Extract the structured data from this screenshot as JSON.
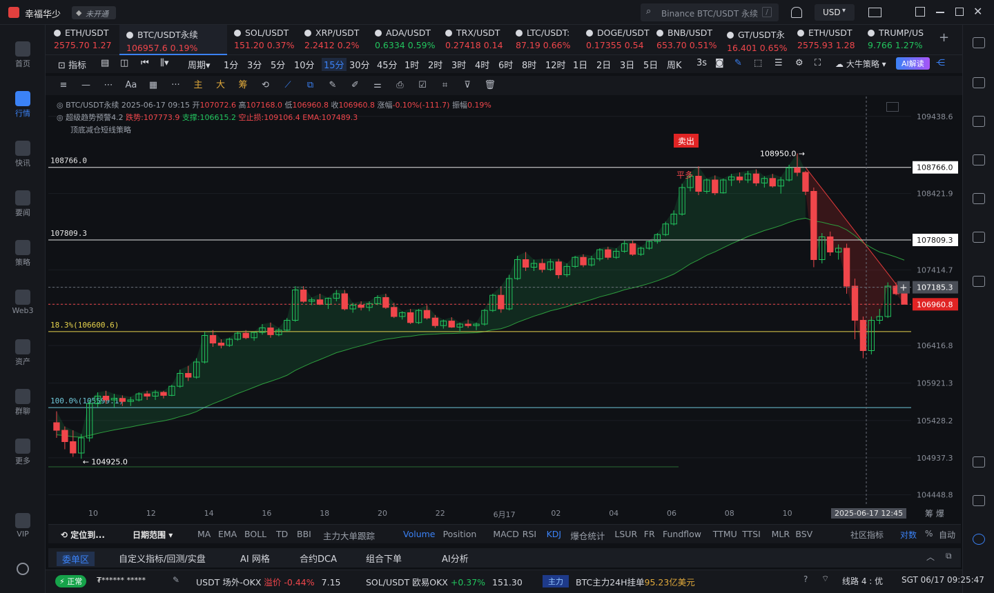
{
  "app": {
    "title": "幸福华少",
    "status_badge": "未开通",
    "search_placeholder": "Binance BTC/USDT 永续",
    "search_shortcut": "/",
    "currency": "USD"
  },
  "left_nav": [
    {
      "label": "首页",
      "icon": "home-icon"
    },
    {
      "label": "行情",
      "icon": "market-icon",
      "active": true
    },
    {
      "label": "快讯",
      "icon": "news-icon"
    },
    {
      "label": "要闻",
      "icon": "headline-icon"
    },
    {
      "label": "策略",
      "icon": "strategy-icon"
    },
    {
      "label": "Web3",
      "icon": "web3-icon"
    },
    {
      "label": "资产",
      "icon": "wallet-icon"
    },
    {
      "label": "群聊",
      "icon": "chat-icon"
    },
    {
      "label": "更多",
      "icon": "more-icon"
    },
    {
      "label": "VIP",
      "icon": "vip-icon"
    }
  ],
  "tickers": [
    {
      "name": "ETH/USDT",
      "price": "2575.70",
      "change": "1.27",
      "dir": "red"
    },
    {
      "name": "BTC/USDT永续",
      "price": "106957.6",
      "change": "0.19%",
      "dir": "red",
      "active": true
    },
    {
      "name": "SOL/USDT",
      "price": "151.20",
      "change": "0.37%",
      "dir": "red"
    },
    {
      "name": "XRP/USDT",
      "price": "2.2412",
      "change": "0.2%",
      "dir": "red"
    },
    {
      "name": "ADA/USDT",
      "price": "0.6334",
      "change": "0.59%",
      "dir": "green"
    },
    {
      "name": "TRX/USDT",
      "price": "0.27418",
      "change": "0.14",
      "dir": "red"
    },
    {
      "name": "LTC/USDT:",
      "price": "87.19",
      "change": "0.66%",
      "dir": "red"
    },
    {
      "name": "DOGE/USDT",
      "price": "0.17355",
      "change": "0.54",
      "dir": "red"
    },
    {
      "name": "BNB/USDT",
      "price": "653.70",
      "change": "0.51%",
      "dir": "red"
    },
    {
      "name": "GT/USDT永",
      "price": "16.401",
      "change": "0.65%",
      "dir": "red"
    },
    {
      "name": "ETH/USDT",
      "price": "2575.93",
      "change": "1.28",
      "dir": "red"
    },
    {
      "name": "TRUMP/US",
      "price": "9.766",
      "change": "1.27%",
      "dir": "green"
    }
  ],
  "period_bar": {
    "indicator_label": "指标",
    "period_label": "周期",
    "periods": [
      "1分",
      "3分",
      "5分",
      "10分",
      "15分",
      "30分",
      "45分",
      "1时",
      "2时",
      "3时",
      "4时",
      "6时",
      "8时",
      "12时",
      "1日",
      "2日",
      "3日",
      "5日",
      "周K"
    ],
    "active_period": "15分",
    "refresh": "3s",
    "strategy": "大牛策略",
    "ai_button": "AI解读"
  },
  "draw_tools": [
    "≡",
    "—",
    "⋯",
    "Aa",
    "▦",
    "···",
    "主",
    "大",
    "筹",
    "⟲",
    "⟋",
    "⧉",
    "✎",
    "✐",
    "⚌",
    "⎙",
    "☑",
    "⌗",
    "⊽",
    "🗑"
  ],
  "chart_info": {
    "line1": {
      "symbol": "BTC/USDT永续",
      "time": "2025-06-17 09:15",
      "open_label": "开",
      "open": "107072.6",
      "high_label": "高",
      "high": "107168.0",
      "low_label": "低",
      "low": "106960.8",
      "close_label": "收",
      "close": "106960.8",
      "chg_label": "涨幅",
      "chg": "-0.10%(-111.7)",
      "amp_label": "振幅",
      "amp": "0.19%"
    },
    "line2": {
      "name": "超级趋势预警4.2",
      "trend_label": "跌势:",
      "trend": "107773.9",
      "support_label": "支撑:",
      "support": "106615.2",
      "stop_label": "空止损:",
      "stop": "109106.4",
      "ema_label": "EMA:",
      "ema": "107489.3"
    },
    "line3": "顶底减仓短线策略"
  },
  "chart_data": {
    "type": "candlestick",
    "symbol": "BTC/USDT永续",
    "interval": "15分",
    "y_ticks": [
      "109438.6",
      "108766.0",
      "108421.9",
      "107809.3",
      "107414.7",
      "107185.3",
      "106960.8",
      "106416.8",
      "105921.3",
      "105428.2",
      "104937.3",
      "104448.8"
    ],
    "x_ticks": [
      "10",
      "12",
      "14",
      "16",
      "18",
      "20",
      "22",
      "6月17",
      "02",
      "04",
      "06",
      "08",
      "10"
    ],
    "crosshair_time": "2025-06-17 12:45",
    "crosshair_price": "107185.3",
    "last_price": "106960.8",
    "ylim": [
      104300,
      109700
    ],
    "hlines": [
      {
        "label": "108766.0",
        "value": 108766.0,
        "color": "#e6e6e6",
        "tag": "108766.0"
      },
      {
        "label": "107809.3",
        "value": 107809.3,
        "color": "#e6e6e6",
        "tag": "107809.3"
      },
      {
        "label": "18.3%(106600.6)",
        "value": 106600.6,
        "color": "#e8d44d"
      },
      {
        "label": "100.0%(105599.1)",
        "value": 105599.1,
        "color": "#6fc7d9"
      }
    ],
    "annotations": [
      {
        "text": "108950.0 →",
        "kind": "high"
      },
      {
        "text": "← 104925.0",
        "kind": "low"
      },
      {
        "text": "卖出",
        "kind": "sell"
      },
      {
        "text": "平多",
        "kind": "close-long"
      }
    ],
    "candles": [
      [
        105400,
        105550,
        105200,
        105300
      ],
      [
        105300,
        105350,
        105050,
        105150
      ],
      [
        105150,
        105300,
        104950,
        105000
      ],
      [
        105000,
        105250,
        104925,
        105200
      ],
      [
        105200,
        105700,
        105150,
        105650
      ],
      [
        105650,
        105800,
        105600,
        105750
      ],
      [
        105750,
        105820,
        105650,
        105700
      ],
      [
        105700,
        105780,
        105600,
        105720
      ],
      [
        105720,
        105760,
        105620,
        105680
      ],
      [
        105680,
        105740,
        105620,
        105700
      ],
      [
        105700,
        105800,
        105680,
        105780
      ],
      [
        105780,
        105820,
        105700,
        105750
      ],
      [
        105750,
        105830,
        105700,
        105800
      ],
      [
        105800,
        105820,
        105720,
        105760
      ],
      [
        105760,
        105900,
        105750,
        105880
      ],
      [
        105880,
        106100,
        105860,
        106050
      ],
      [
        106050,
        106150,
        105950,
        106000
      ],
      [
        106000,
        106250,
        105980,
        106200
      ],
      [
        106200,
        106600,
        106180,
        106550
      ],
      [
        106550,
        106620,
        106400,
        106450
      ],
      [
        106450,
        106500,
        106380,
        106420
      ],
      [
        106420,
        106520,
        106400,
        106500
      ],
      [
        106500,
        106600,
        106480,
        106580
      ],
      [
        106580,
        106620,
        106500,
        106520
      ],
      [
        106520,
        106600,
        106480,
        106590
      ],
      [
        106590,
        106700,
        106560,
        106650
      ],
      [
        106650,
        106720,
        106520,
        106560
      ],
      [
        106560,
        106650,
        106540,
        106620
      ],
      [
        106620,
        106780,
        106600,
        106750
      ],
      [
        106750,
        107200,
        106730,
        107150
      ],
      [
        107150,
        107200,
        106980,
        107000
      ],
      [
        107000,
        107050,
        106950,
        107020
      ],
      [
        107020,
        107100,
        106950,
        106960
      ],
      [
        106960,
        107050,
        106900,
        107040
      ],
      [
        107040,
        107150,
        107000,
        107100
      ],
      [
        107100,
        107150,
        106880,
        106900
      ],
      [
        106900,
        106980,
        106850,
        106950
      ],
      [
        106950,
        107000,
        106880,
        106920
      ],
      [
        106920,
        107000,
        106870,
        106970
      ],
      [
        106970,
        107080,
        106950,
        107050
      ],
      [
        107050,
        107100,
        106900,
        106920
      ],
      [
        106920,
        106980,
        106780,
        106800
      ],
      [
        106800,
        106870,
        106760,
        106850
      ],
      [
        106850,
        106900,
        106700,
        106720
      ],
      [
        106720,
        106900,
        106700,
        106880
      ],
      [
        106880,
        106950,
        106760,
        106780
      ],
      [
        106780,
        106820,
        106650,
        106680
      ],
      [
        106680,
        106760,
        106640,
        106740
      ],
      [
        106740,
        106790,
        106650,
        106660
      ],
      [
        106660,
        106720,
        106600,
        106700
      ],
      [
        106700,
        106760,
        106650,
        106680
      ],
      [
        106680,
        106720,
        106620,
        106700
      ],
      [
        106700,
        106900,
        106680,
        106880
      ],
      [
        106880,
        107100,
        106860,
        107080
      ],
      [
        107080,
        107200,
        106850,
        106900
      ],
      [
        106900,
        107350,
        106880,
        107300
      ],
      [
        107300,
        107600,
        107280,
        107550
      ],
      [
        107550,
        107650,
        107400,
        107450
      ],
      [
        107450,
        107550,
        107400,
        107500
      ],
      [
        107500,
        107560,
        107380,
        107420
      ],
      [
        107420,
        107560,
        107400,
        107520
      ],
      [
        107520,
        107560,
        107300,
        107350
      ],
      [
        107350,
        107500,
        107320,
        107460
      ],
      [
        107460,
        107600,
        107440,
        107580
      ],
      [
        107580,
        107620,
        107450,
        107480
      ],
      [
        107480,
        107600,
        107460,
        107560
      ],
      [
        107560,
        107700,
        107530,
        107680
      ],
      [
        107680,
        107720,
        107550,
        107580
      ],
      [
        107580,
        107700,
        107560,
        107660
      ],
      [
        107660,
        107800,
        107640,
        107760
      ],
      [
        107760,
        107800,
        107600,
        107620
      ],
      [
        107620,
        107720,
        107600,
        107700
      ],
      [
        107700,
        107800,
        107680,
        107790
      ],
      [
        107790,
        107900,
        107760,
        107880
      ],
      [
        107880,
        108050,
        107860,
        108020
      ],
      [
        108020,
        108200,
        108000,
        108150
      ],
      [
        108150,
        108550,
        108130,
        108500
      ],
      [
        108500,
        108700,
        108450,
        108650
      ],
      [
        108650,
        108780,
        108400,
        108450
      ],
      [
        108450,
        108620,
        108420,
        108600
      ],
      [
        108600,
        108660,
        108400,
        108430
      ],
      [
        108430,
        108620,
        108420,
        108600
      ],
      [
        108600,
        108680,
        108520,
        108640
      ],
      [
        108640,
        108700,
        108560,
        108600
      ],
      [
        108600,
        108720,
        108560,
        108680
      ],
      [
        108680,
        108740,
        108520,
        108560
      ],
      [
        108560,
        108650,
        108500,
        108620
      ],
      [
        108620,
        108680,
        108500,
        108520
      ],
      [
        108520,
        108640,
        108420,
        108600
      ],
      [
        108600,
        108800,
        108580,
        108760
      ],
      [
        108760,
        108950,
        108650,
        108700
      ],
      [
        108700,
        108720,
        108400,
        108450
      ],
      [
        108450,
        108500,
        107450,
        107550
      ],
      [
        107550,
        107900,
        107500,
        107850
      ],
      [
        107850,
        107920,
        107600,
        107650
      ],
      [
        107650,
        107750,
        107550,
        107700
      ],
      [
        107700,
        107760,
        107100,
        107200
      ],
      [
        107200,
        107300,
        106500,
        106750
      ],
      [
        106750,
        106800,
        106250,
        106350
      ],
      [
        106350,
        106800,
        106300,
        106750
      ],
      [
        106750,
        106900,
        106700,
        106800
      ],
      [
        106800,
        107250,
        106780,
        107200
      ],
      [
        107200,
        107250,
        107080,
        107100
      ],
      [
        107100,
        107168,
        106960.8,
        106960.8
      ]
    ]
  },
  "indicator_bar": {
    "locate": "定位到...",
    "range": "日期范围",
    "main": [
      "MA",
      "EMA",
      "BOLL",
      "TD",
      "BBI",
      "主力大单跟踪"
    ],
    "sub": [
      "Volume",
      "Position",
      "MACD",
      "RSI",
      "KDJ",
      "爆仓统计",
      "LSUR",
      "FR",
      "Fundflow",
      "TTMU",
      "TTSI",
      "MLR",
      "BSV"
    ],
    "active_sub": "Volume",
    "highlight_sub": "KDJ",
    "community": "社区指标",
    "log": "对数",
    "percent": "%",
    "auto": "自动"
  },
  "bottom_tabs": [
    "委单区",
    "自定义指标/回测/实盘",
    "AI 网格",
    "合约DCA",
    "组合下单",
    "AI分析"
  ],
  "status": {
    "conn": "正常",
    "user": "₮****** *****",
    "items": [
      {
        "name": "USDT 场外-OKX",
        "label": "溢价",
        "chg": "-0.44%",
        "val": "7.15"
      },
      {
        "name": "SOL/USDT 欧易OKX",
        "chg": "+0.37%",
        "val": "151.30"
      }
    ],
    "main_tag": "主力",
    "main_text": "BTC主力24H挂单",
    "main_val": "95.23亿美元",
    "line": "线路 4 : 优",
    "time": "SGT 06/17 09:25:47"
  }
}
